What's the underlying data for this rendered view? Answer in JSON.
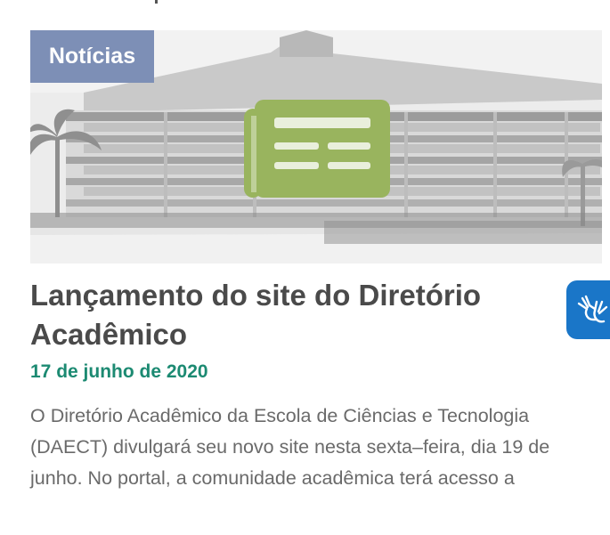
{
  "news_card": {
    "category": "Notícias",
    "title": "Lançamento do site do Diretório Acadêmico",
    "date": "17 de junho de 2020",
    "excerpt": "O Diretório Acadêmico da Escola de Ciências e Tecnologia (DAECT) divulgará seu novo site nesta sexta–feira, dia 19 de junho. No portal, a comunidade acadêmica terá acesso a",
    "thumbnail_icon": "newspaper-icon"
  },
  "accessibility": {
    "icon": "sign-language-hands-icon"
  },
  "colors": {
    "category_bg": "#7d8fb6",
    "title": "#4a4a4a",
    "date": "#1c8a72",
    "excerpt": "#6a6a6a",
    "newspaper_icon": "#99b45e",
    "accessibility_bg": "#1a76c8"
  }
}
